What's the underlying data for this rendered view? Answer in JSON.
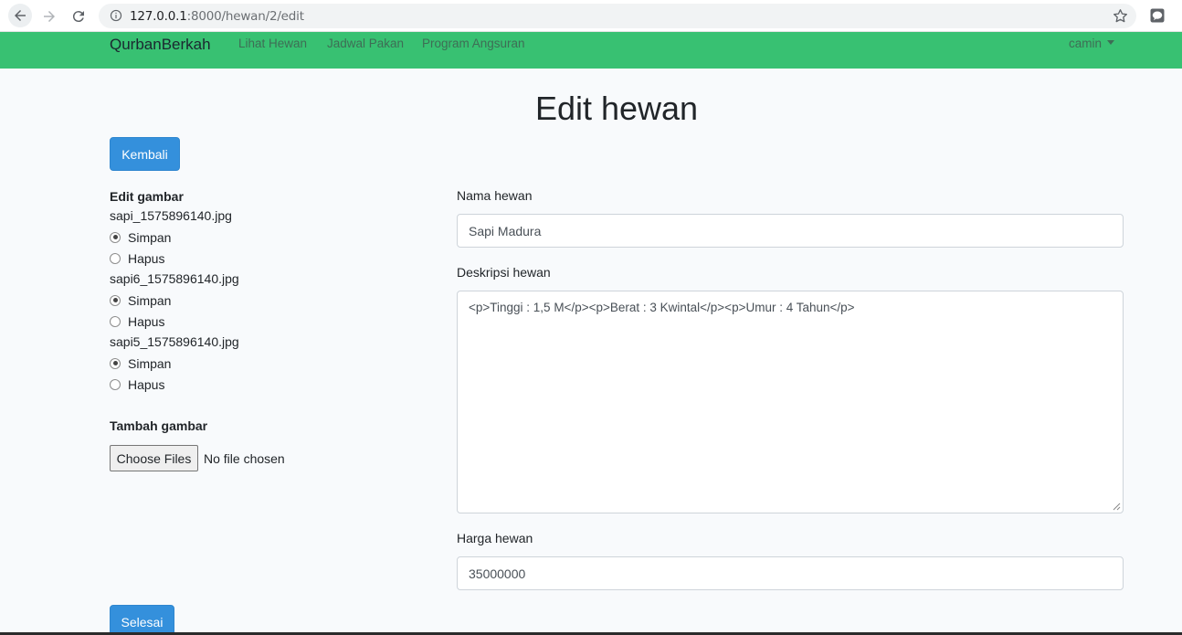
{
  "browser": {
    "url_host": "127.0.0.1",
    "url_rest": ":8000/hewan/2/edit"
  },
  "navbar": {
    "brand": "QurbanBerkah",
    "links": [
      "Lihat Hewan",
      "Jadwal Pakan",
      "Program Angsuran"
    ],
    "user": "camin",
    "color": "#38c172"
  },
  "page": {
    "title": "Edit hewan",
    "back_label": "Kembali",
    "done_label": "Selesai"
  },
  "images": {
    "section_title": "Edit gambar",
    "items": [
      {
        "file": "sapi_1575896140.jpg",
        "keep": "Simpan",
        "delete": "Hapus",
        "selected": "Simpan"
      },
      {
        "file": "sapi6_1575896140.jpg",
        "keep": "Simpan",
        "delete": "Hapus",
        "selected": "Simpan"
      },
      {
        "file": "sapi5_1575896140.jpg",
        "keep": "Simpan",
        "delete": "Hapus",
        "selected": "Simpan"
      }
    ],
    "add_title": "Tambah gambar",
    "choose_label": "Choose Files",
    "no_file": "No file chosen"
  },
  "form": {
    "name_label": "Nama hewan",
    "name_value": "Sapi Madura",
    "desc_label": "Deskripsi hewan",
    "desc_value": "<p>Tinggi : 1,5 M</p><p>Berat : 3 Kwintal</p><p>Umur : 4 Tahun</p>",
    "price_label": "Harga hewan",
    "price_value": "35000000"
  },
  "colors": {
    "primary": "#3490dc",
    "success": "#38c172"
  }
}
